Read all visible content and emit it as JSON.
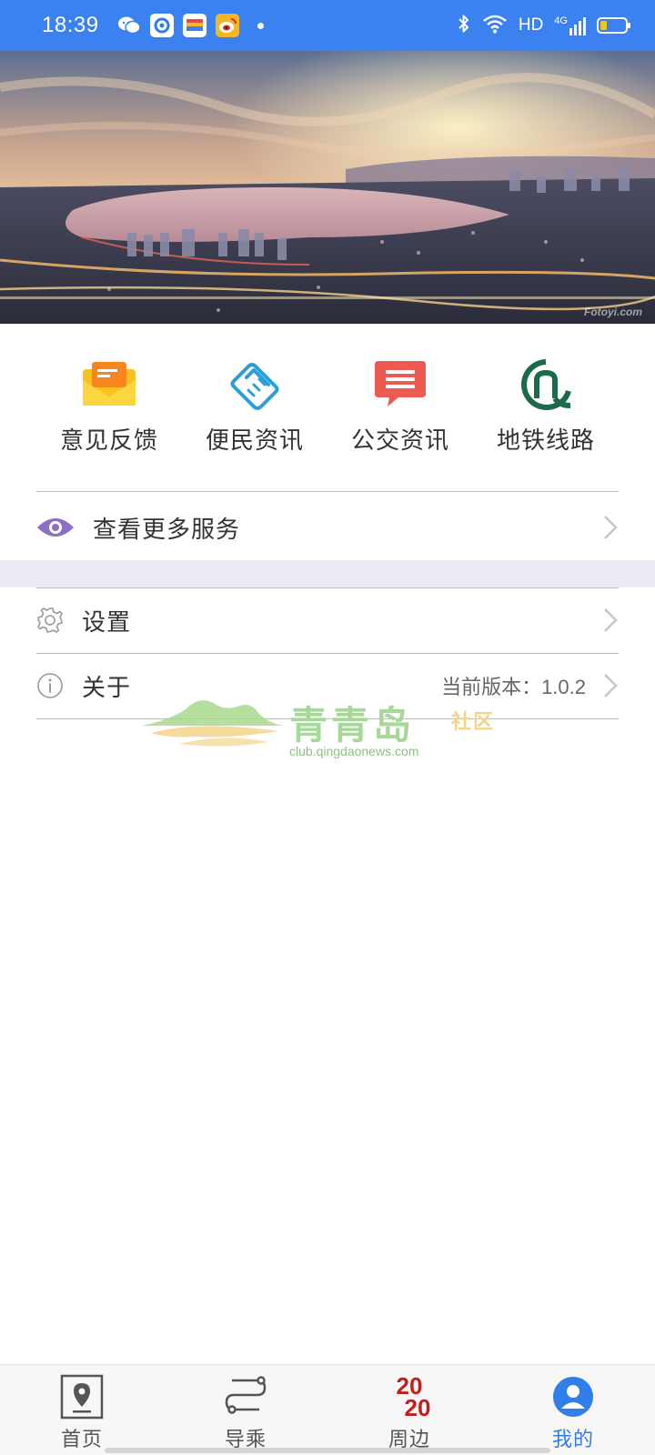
{
  "status_bar": {
    "time": "18:39",
    "apps": [
      "wechat-icon",
      "app-circle-icon",
      "wallet-icon",
      "weibo-icon"
    ],
    "network": "HD",
    "cellular": "4G",
    "battery_fraction": 0.25
  },
  "hero": {
    "watermark": "Fotoyi.com"
  },
  "services": [
    {
      "label": "意见反馈",
      "icon": "feedback-envelope-icon",
      "color": "#f8c21e"
    },
    {
      "label": "便民资讯",
      "icon": "handshake-icon",
      "color": "#2b9fd6"
    },
    {
      "label": "公交资讯",
      "icon": "chat-bubble-icon",
      "color": "#ec5a52"
    },
    {
      "label": "地铁线路",
      "icon": "metro-logo-icon",
      "color": "#1a6b4a"
    }
  ],
  "more_services": {
    "label": "查看更多服务",
    "icon": "eye-icon",
    "icon_color": "#8e6fc8"
  },
  "menu": {
    "settings": {
      "label": "设置",
      "icon": "gear-icon"
    },
    "about": {
      "label": "关于",
      "icon": "info-icon",
      "version": "当前版本：1.0.2"
    }
  },
  "watermark": {
    "brand": "青青岛",
    "brand_sub": "社区",
    "url": "club.qingdaonews.com"
  },
  "bottom_nav": {
    "items": [
      {
        "label": "首页",
        "icon": "map-pin-icon"
      },
      {
        "label": "导乘",
        "icon": "route-icon"
      },
      {
        "label": "周边",
        "icon": "year-2020-icon",
        "badge_top": "20",
        "badge_bottom": "20"
      },
      {
        "label": "我的",
        "icon": "user-icon",
        "active": true
      }
    ],
    "active_color": "#2f7ee9"
  }
}
